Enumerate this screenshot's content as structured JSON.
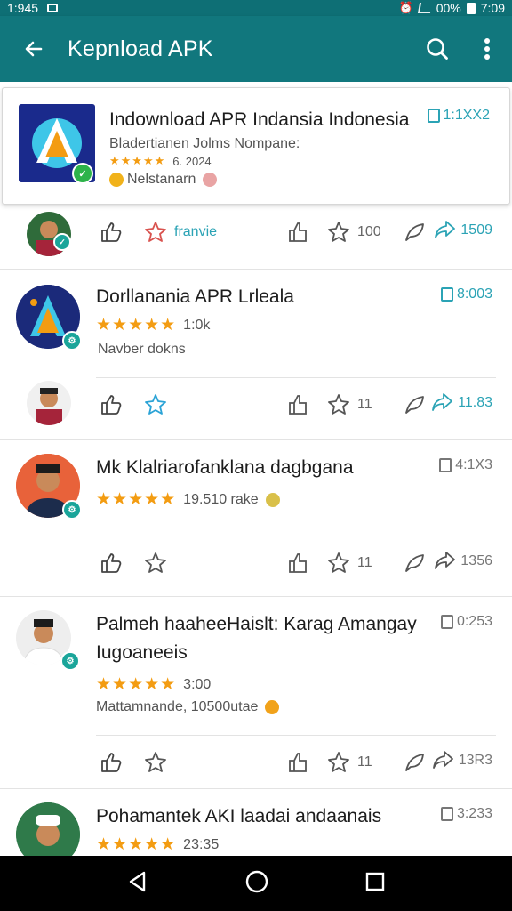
{
  "status_bar": {
    "time_left": "1:945",
    "battery": "00%",
    "time_right": "7:09"
  },
  "app_bar": {
    "title": "Kepnload APK"
  },
  "featured": {
    "title": "Indownload APR Indansia Indonesia",
    "subtitle": "Bladertianen Jolms Nompane:",
    "stars": "★★★★★",
    "rating_text": "6. 2024",
    "meta": "Nelstanarn",
    "counter": "1:1XX2"
  },
  "row1": {
    "follow_label": "franvie",
    "like_count": "100",
    "share_count": "1509"
  },
  "item2": {
    "title": "Dorllanania APR Lrleala",
    "stars": "★★★★★",
    "rating_text": "1:0k",
    "meta": "Navber dokns",
    "counter": "8:003",
    "like_count": "11",
    "share_count": "11.83"
  },
  "item3": {
    "title": "Mk Klalriarofanklana dagbgana",
    "stars": "★★★★★",
    "rating_text": "19.510 rake",
    "counter": "4:1X3",
    "like_count": "11",
    "share_count": "1356"
  },
  "item4": {
    "title": "Palmeh haaheeHaislt: Karag Amangay",
    "title2": "Iugoaneeis",
    "stars": "★★★★★",
    "rating_text": "3:00",
    "meta": "Mattamnande, 10500utae",
    "counter": "0:253",
    "like_count": "11",
    "share_count": "13R3"
  },
  "item5": {
    "title": "Pohamantek AKI laadai andaanais",
    "stars": "★★★★★",
    "rating_text": "23:35",
    "counter": "3:233"
  },
  "colors": {
    "appbar": "#11777d",
    "status": "#0e6f75",
    "accent": "#2ba3b5",
    "star": "#f39c12"
  }
}
